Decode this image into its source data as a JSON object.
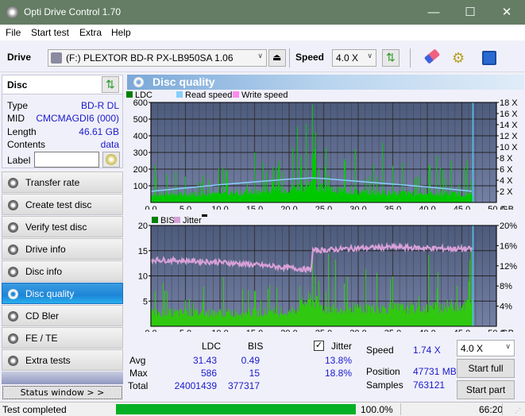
{
  "window": {
    "title": "Opti Drive Control 1.70",
    "minimize": "—",
    "maximize": "☐",
    "close": "✕"
  },
  "menu": [
    {
      "label": "File"
    },
    {
      "label": "Start test"
    },
    {
      "label": "Extra"
    },
    {
      "label": "Help"
    }
  ],
  "toolbar": {
    "drive_label": "Drive",
    "drive_value": "(F:)  PLEXTOR BD-R  PX-LB950SA 1.06",
    "speed_label": "Speed",
    "speed_value": "4.0 X"
  },
  "disc": {
    "header": "Disc",
    "rows": [
      {
        "key": "Type",
        "value": "BD-R DL"
      },
      {
        "key": "MID",
        "value": "CMCMAGDI6 (000)"
      },
      {
        "key": "Length",
        "value": "46.61 GB"
      },
      {
        "key": "Contents",
        "value": "data"
      }
    ],
    "label_key": "Label",
    "label_value": ""
  },
  "nav": [
    {
      "label": "Transfer rate",
      "active": false
    },
    {
      "label": "Create test disc",
      "active": false
    },
    {
      "label": "Verify test disc",
      "active": false
    },
    {
      "label": "Drive info",
      "active": false
    },
    {
      "label": "Disc info",
      "active": false
    },
    {
      "label": "Disc quality",
      "active": true
    },
    {
      "label": "CD Bler",
      "active": false
    },
    {
      "label": "FE / TE",
      "active": false
    },
    {
      "label": "Extra tests",
      "active": false
    }
  ],
  "status_window_label": "Status window > >",
  "main": {
    "title": "Disc quality"
  },
  "chart_data": [
    {
      "type": "bar",
      "title": "LDC / Read speed",
      "legend": [
        {
          "name": "LDC",
          "color": "#008000"
        },
        {
          "name": "Read speed",
          "color": "#87cefa"
        },
        {
          "name": "Write speed",
          "color": "#ff88ee"
        }
      ],
      "xlabel": "GB",
      "xlim": [
        0,
        50
      ],
      "x_ticks": [
        "0.0",
        "5.0",
        "10.0",
        "15.0",
        "20.0",
        "25.0",
        "30.0",
        "35.0",
        "40.0",
        "45.0",
        "50.0"
      ],
      "ylim": [
        0,
        600
      ],
      "y_ticks": [
        "100",
        "200",
        "300",
        "400",
        "500",
        "600"
      ],
      "y2lim": [
        0,
        18
      ],
      "y2_ticks": [
        "2 X",
        "4 X",
        "6 X",
        "8 X",
        "10 X",
        "12 X",
        "14 X",
        "16 X",
        "18 X"
      ],
      "grid": true,
      "end_position_gb": 46.61,
      "ldc_baseline": [
        [
          0,
          55
        ],
        [
          5,
          55
        ],
        [
          10,
          60
        ],
        [
          15,
          70
        ],
        [
          20,
          90
        ],
        [
          23,
          120
        ],
        [
          25,
          90
        ],
        [
          30,
          70
        ],
        [
          35,
          65
        ],
        [
          40,
          60
        ],
        [
          46.6,
          55
        ]
      ],
      "ldc_spikes": [
        [
          0.6,
          225
        ],
        [
          3.6,
          185
        ],
        [
          10.3,
          210
        ],
        [
          10.8,
          200
        ],
        [
          14.9,
          300
        ],
        [
          20.5,
          330
        ],
        [
          21.2,
          455
        ],
        [
          23.3,
          586
        ],
        [
          23.8,
          420
        ],
        [
          25.3,
          330
        ],
        [
          29.5,
          320
        ],
        [
          33.5,
          360
        ],
        [
          36.3,
          240
        ],
        [
          41.3,
          280
        ],
        [
          43.5,
          250
        ],
        [
          45.8,
          255
        ]
      ],
      "read_speed_x": [
        [
          0,
          2.0
        ],
        [
          5,
          2.6
        ],
        [
          10,
          3.2
        ],
        [
          15,
          3.7
        ],
        [
          20,
          4.2
        ],
        [
          23.3,
          4.4
        ],
        [
          25,
          4.3
        ],
        [
          30,
          3.8
        ],
        [
          35,
          3.3
        ],
        [
          40,
          2.8
        ],
        [
          46.6,
          2.0
        ]
      ]
    },
    {
      "type": "bar",
      "title": "BIS / Jitter",
      "legend": [
        {
          "name": "BIS",
          "color": "#008000"
        },
        {
          "name": "Jitter",
          "color": "#d8a0d8"
        }
      ],
      "xlabel": "GB",
      "xlim": [
        0,
        50
      ],
      "x_ticks": [
        "0.0",
        "5.0",
        "10.0",
        "15.0",
        "20.0",
        "25.0",
        "30.0",
        "35.0",
        "40.0",
        "45.0",
        "50.0"
      ],
      "ylim": [
        0,
        20
      ],
      "y_ticks": [
        "5",
        "10",
        "15",
        "20"
      ],
      "y2lim": [
        0,
        20
      ],
      "y2_ticks": [
        "4%",
        "8%",
        "12%",
        "16%",
        "20%"
      ],
      "grid": true,
      "end_position_gb": 46.61,
      "bis_baseline": [
        [
          0,
          3
        ],
        [
          20,
          3
        ],
        [
          21,
          4
        ],
        [
          23,
          6
        ],
        [
          25,
          4
        ],
        [
          40,
          4
        ],
        [
          46.6,
          5
        ]
      ],
      "bis_spikes": [
        [
          0.6,
          7
        ],
        [
          15,
          7
        ],
        [
          21.5,
          8
        ],
        [
          23.3,
          14
        ],
        [
          23.8,
          10
        ],
        [
          24.3,
          9
        ],
        [
          46,
          9
        ]
      ],
      "jitter_pct": [
        [
          0,
          13.2
        ],
        [
          5,
          13.0
        ],
        [
          10,
          12.7
        ],
        [
          15,
          12.2
        ],
        [
          20,
          11.6
        ],
        [
          23.2,
          11.2
        ],
        [
          23.4,
          15.0
        ],
        [
          30,
          15.5
        ],
        [
          35,
          15.7
        ],
        [
          40,
          15.5
        ],
        [
          46.6,
          15.3
        ]
      ]
    }
  ],
  "stats": {
    "col_ldc": "LDC",
    "col_bis": "BIS",
    "jitter_checkbox_label": "Jitter",
    "jitter_checked": true,
    "rows": [
      {
        "label": "Avg",
        "ldc": "31.43",
        "bis": "0.49",
        "jitter": "13.8%"
      },
      {
        "label": "Max",
        "ldc": "586",
        "bis": "15",
        "jitter": "18.8%"
      },
      {
        "label": "Total",
        "ldc": "24001439",
        "bis": "377317",
        "jitter": ""
      }
    ],
    "speed_label": "Speed",
    "speed_value": "1.74 X",
    "position_label": "Position",
    "position_value": "47731 MB",
    "samples_label": "Samples",
    "samples_value": "763121",
    "speed_select": "4.0 X",
    "start_full": "Start full",
    "start_part": "Start part"
  },
  "statusbar": {
    "text": "Test completed",
    "progress": 1.0,
    "progress_text": "100.0%",
    "time": "66:20"
  }
}
